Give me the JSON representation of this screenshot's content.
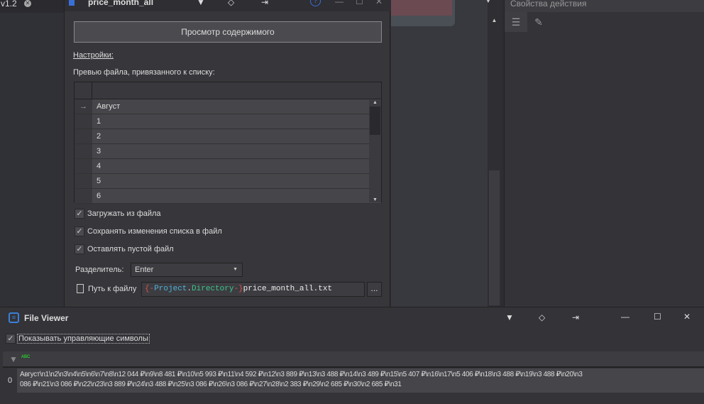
{
  "tabs": {
    "version": "v1.2"
  },
  "dialog": {
    "title": "price_month_all",
    "view_button": "Просмотр содержимого",
    "settings_link": "Настройки:",
    "preview_label": "Превью файла, привязанного к списку:",
    "rows": [
      "Август",
      "1",
      "2",
      "3",
      "4",
      "5",
      "6"
    ],
    "checkboxes": [
      {
        "label": "Загружать из файла",
        "checked": true
      },
      {
        "label": "Сохранять изменения списка в файл",
        "checked": true
      },
      {
        "label": "Оставлять пустой файл",
        "checked": true
      }
    ],
    "separator_label": "Разделитель:",
    "separator_value": "Enter",
    "path_label": "Путь к файлу",
    "path_open": "{-",
    "path_var1": "Project",
    "path_dot": ".",
    "path_var2": "Directory",
    "path_close": "-}",
    "path_file": "price_month_all.txt",
    "browse": "..."
  },
  "right_panel": {
    "title": "Свойства действия"
  },
  "file_viewer": {
    "title": "File Viewer",
    "show_control_chars": "Показывать управляющие символы",
    "column_icon": "ABC",
    "row_index": "0",
    "line1": "Август\\n1\\n2\\n3\\n4\\n5\\n6\\n7\\n8\\n12 044 ₽\\n9\\n8 481 ₽\\n10\\n5 993 ₽\\n11\\n4 592 ₽\\n12\\n3 889 ₽\\n13\\n3 488 ₽\\n14\\n3 489 ₽\\n15\\n5 407 ₽\\n16\\n17\\n5 406 ₽\\n18\\n3 488 ₽\\n19\\n3 488 ₽\\n20\\n3",
    "line2": "086 ₽\\n21\\n3 086 ₽\\n22\\n23\\n3 889 ₽\\n24\\n3 488 ₽\\n25\\n3 086 ₽\\n26\\n3 086 ₽\\n27\\n28\\n2 383 ₽\\n29\\n2 685 ₽\\n30\\n2 685 ₽\\n31"
  }
}
